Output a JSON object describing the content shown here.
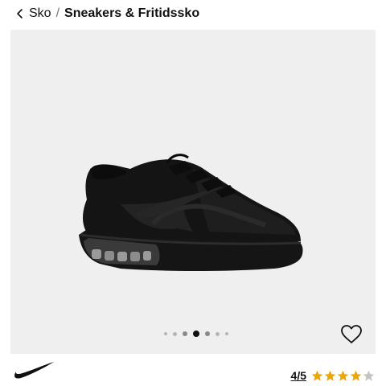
{
  "breadcrumb": {
    "parent_label": "Sko",
    "separator": "/",
    "current_label": "Sneakers & Fritidssko"
  },
  "gallery": {
    "image_icon": "black-running-shoe",
    "background_color": "#efefef",
    "slide_count": 7,
    "active_slide_index": 3
  },
  "favorite": {
    "icon": "heart-outline-icon"
  },
  "brand": {
    "logo_icon": "swoosh-logo"
  },
  "rating": {
    "value_label": "4/5",
    "stars_total": 5,
    "stars_filled": 4,
    "filled_color": "#f0a500",
    "empty_color": "#c4c4c4"
  }
}
